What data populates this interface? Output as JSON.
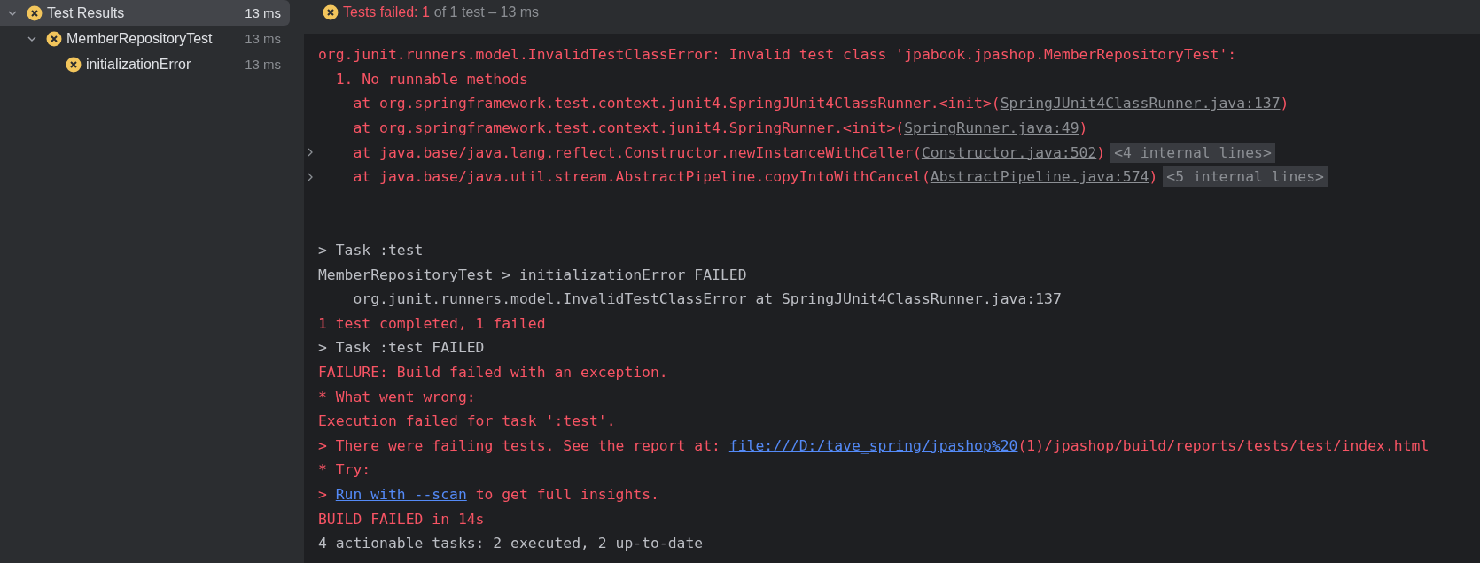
{
  "tree": [
    {
      "label": "Test Results",
      "time": "13 ms",
      "failed": true,
      "expanded": true,
      "selected": true,
      "children": [
        {
          "label": "MemberRepositoryTest",
          "time": "13 ms",
          "failed": true,
          "expanded": true,
          "selected": false,
          "children": [
            {
              "label": "initializationError",
              "time": "13 ms",
              "failed": true,
              "selected": false
            }
          ]
        }
      ]
    }
  ],
  "header": {
    "failed": true,
    "failed_text": "Tests failed: 1",
    "summary": "of 1 test – 13 ms"
  },
  "console": [
    {
      "kind": "error",
      "segments": [
        {
          "text": "org.junit.runners.model.InvalidTestClassError: Invalid test class 'jpabook.jpashop.MemberRepositoryTest':"
        }
      ]
    },
    {
      "kind": "error",
      "segments": [
        {
          "text": "  1. No runnable methods"
        }
      ]
    },
    {
      "kind": "error",
      "segments": [
        {
          "text": "    at org.springframework.test.context.junit4.SpringJUnit4ClassRunner.<init>("
        },
        {
          "text": "SpringJUnit4ClassRunner.java:137",
          "kind": "file"
        },
        {
          "text": ")"
        }
      ]
    },
    {
      "kind": "error",
      "segments": [
        {
          "text": "    at org.springframework.test.context.junit4.SpringRunner.<init>("
        },
        {
          "text": "SpringRunner.java:49",
          "kind": "file"
        },
        {
          "text": ")"
        }
      ]
    },
    {
      "kind": "error",
      "expandable": true,
      "folded": "<4 internal lines>",
      "segments": [
        {
          "text": "    at java.base/java.lang.reflect.Constructor.newInstanceWithCaller("
        },
        {
          "text": "Constructor.java:502",
          "kind": "file"
        },
        {
          "text": ")"
        }
      ]
    },
    {
      "kind": "error",
      "expandable": true,
      "folded": "<5 internal lines>",
      "segments": [
        {
          "text": "    at java.base/java.util.stream.AbstractPipeline.copyIntoWithCancel("
        },
        {
          "text": "AbstractPipeline.java:574",
          "kind": "file"
        },
        {
          "text": ")"
        }
      ]
    },
    {
      "kind": "blank"
    },
    {
      "kind": "blank"
    },
    {
      "kind": "plain",
      "segments": [
        {
          "text": "> Task :test"
        }
      ]
    },
    {
      "kind": "plain",
      "segments": [
        {
          "text": "MemberRepositoryTest > initializationError FAILED"
        }
      ]
    },
    {
      "kind": "plain",
      "segments": [
        {
          "text": "    org.junit.runners.model.InvalidTestClassError at SpringJUnit4ClassRunner.java:137"
        }
      ]
    },
    {
      "kind": "error",
      "segments": [
        {
          "text": "1 test completed, 1 failed"
        }
      ]
    },
    {
      "kind": "plain",
      "segments": [
        {
          "text": "> Task :test FAILED"
        }
      ]
    },
    {
      "kind": "error",
      "segments": [
        {
          "text": "FAILURE: Build failed with an exception."
        }
      ]
    },
    {
      "kind": "error",
      "segments": [
        {
          "text": "* What went wrong:"
        }
      ]
    },
    {
      "kind": "error",
      "segments": [
        {
          "text": "Execution failed for task ':test'."
        }
      ]
    },
    {
      "kind": "error",
      "segments": [
        {
          "text": "> There were failing tests. See the report at: "
        },
        {
          "text": "file:///D:/tave_spring/jpashop%20",
          "kind": "url"
        },
        {
          "text": "(1)/jpashop/build/reports/tests/test/index.html"
        }
      ]
    },
    {
      "kind": "error",
      "segments": [
        {
          "text": "* Try:"
        }
      ]
    },
    {
      "kind": "error",
      "segments": [
        {
          "text": "> "
        },
        {
          "text": "Run with --scan",
          "kind": "url"
        },
        {
          "text": " to get full insights."
        }
      ]
    },
    {
      "kind": "error",
      "segments": [
        {
          "text": "BUILD FAILED in 14s"
        }
      ]
    },
    {
      "kind": "plain",
      "segments": [
        {
          "text": "4 actionable tasks: 2 executed, 2 up-to-date"
        }
      ]
    }
  ]
}
